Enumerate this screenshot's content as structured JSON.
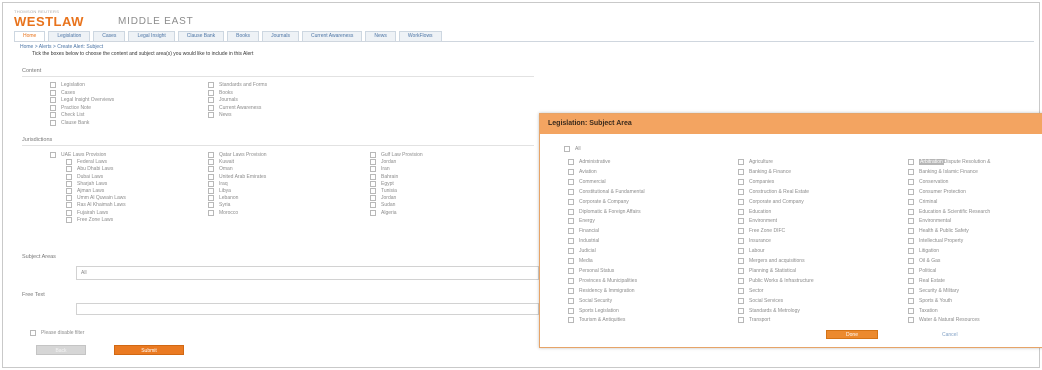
{
  "brand": {
    "top_line": "THOMSON REUTERS",
    "name": "WESTLAW",
    "region": "MIDDLE EAST"
  },
  "nav": {
    "tabs": [
      {
        "label": "Home",
        "active": true
      },
      {
        "label": "Legislation",
        "active": false
      },
      {
        "label": "Cases",
        "active": false
      },
      {
        "label": "Legal Insight",
        "active": false
      },
      {
        "label": "Clause Bank",
        "active": false
      },
      {
        "label": "Books",
        "active": false
      },
      {
        "label": "Journals",
        "active": false
      },
      {
        "label": "Current Awareness",
        "active": false
      },
      {
        "label": "News",
        "active": false
      },
      {
        "label": "WorkFlows",
        "active": false
      }
    ]
  },
  "breadcrumb": "Home > Alerts > Create Alert: Subject",
  "intro_text": "Tick the boxes below to choose the content and subject area(s) you would like to include in this Alert",
  "content": {
    "heading": "Content",
    "col1": [
      "Legislation",
      "Cases",
      "Legal Insight Overviews",
      "Practice Note",
      "Check List",
      "Clause Bank"
    ],
    "col2": [
      "Standards and Forms",
      "Books",
      "Journals",
      "Current Awareness",
      "News"
    ]
  },
  "jurisdictions": {
    "heading": "Jurisdictions",
    "col1": [
      "UAE Laws Provision",
      "Federal Laws",
      "Abu Dhabi Laws",
      "Dubai Laws",
      "Sharjah Laws",
      "Ajman Laws",
      "Umm Al Quwain Laws",
      "Ras Al Khaimah Laws",
      "Fujairah Laws",
      "Free Zone Laws"
    ],
    "col2": [
      "Qatar Laws Provision",
      "Kuwait",
      "Oman",
      "United Arab Emirates",
      "Iraq",
      "Libya",
      "Lebanon",
      "Syria",
      "Morocco"
    ],
    "col3": [
      "Gulf Law Provision",
      "Jordan",
      "Iran",
      "Bahrain",
      "Egypt",
      "Tunisia",
      "Jordan",
      "Sudan",
      "Algeria"
    ]
  },
  "subject_areas": {
    "label": "Subject Areas",
    "value": "All"
  },
  "free_text": {
    "label": "Free Text",
    "value": ""
  },
  "footer": {
    "checkbox_label": "Please disable filter",
    "back_label": "Back",
    "submit_label": "Submit"
  },
  "modal": {
    "title": "Legislation: Subject Area",
    "all_label": "All",
    "col1": [
      "Administrative",
      "Aviation",
      "Commercial",
      "Constitutional & Fundamental",
      "Corporate & Company",
      "Diplomatic & Foreign Affairs",
      "Energy",
      "Financial",
      "Industrial",
      "Judicial",
      "Media",
      "Personal Status",
      "Provinces & Municipalities",
      "Residency & Immigration",
      "Social Security",
      "Sports Legislation",
      "Tourism & Antiquities"
    ],
    "col2": [
      "Agriculture",
      "Banking & Finance",
      "Companies",
      "Construction & Real Estate",
      "Corporate and Company",
      "Education",
      "Environment",
      "Free Zone DIFC",
      "Insurance",
      "Labour",
      "Mergers and acquisitions",
      "Planning & Statistical",
      "Public Works & Infrastructure",
      "Sector",
      "Social Services",
      "Standards & Metrology",
      "Transport"
    ],
    "col3_first_highlight": "Arbitration",
    "col3_first_rest": " Dispute Resolution &",
    "col3": [
      "Banking & Islamic Finance",
      "Conservation",
      "Consumer Protection",
      "Criminal",
      "Education & Scientific Research",
      "Environmental",
      "Health & Public Safety",
      "Intellectual Property",
      "Litigation",
      "Oil & Gas",
      "Political",
      "Real Estate",
      "Security & Military",
      "Sports & Youth",
      "Taxation",
      "Water & Natural Resources"
    ],
    "done_label": "Done",
    "cancel_label": "Cancel"
  },
  "colors": {
    "brand_orange": "#e8731c",
    "modal_header": "#f3a461",
    "link_blue": "#4b74a5"
  }
}
